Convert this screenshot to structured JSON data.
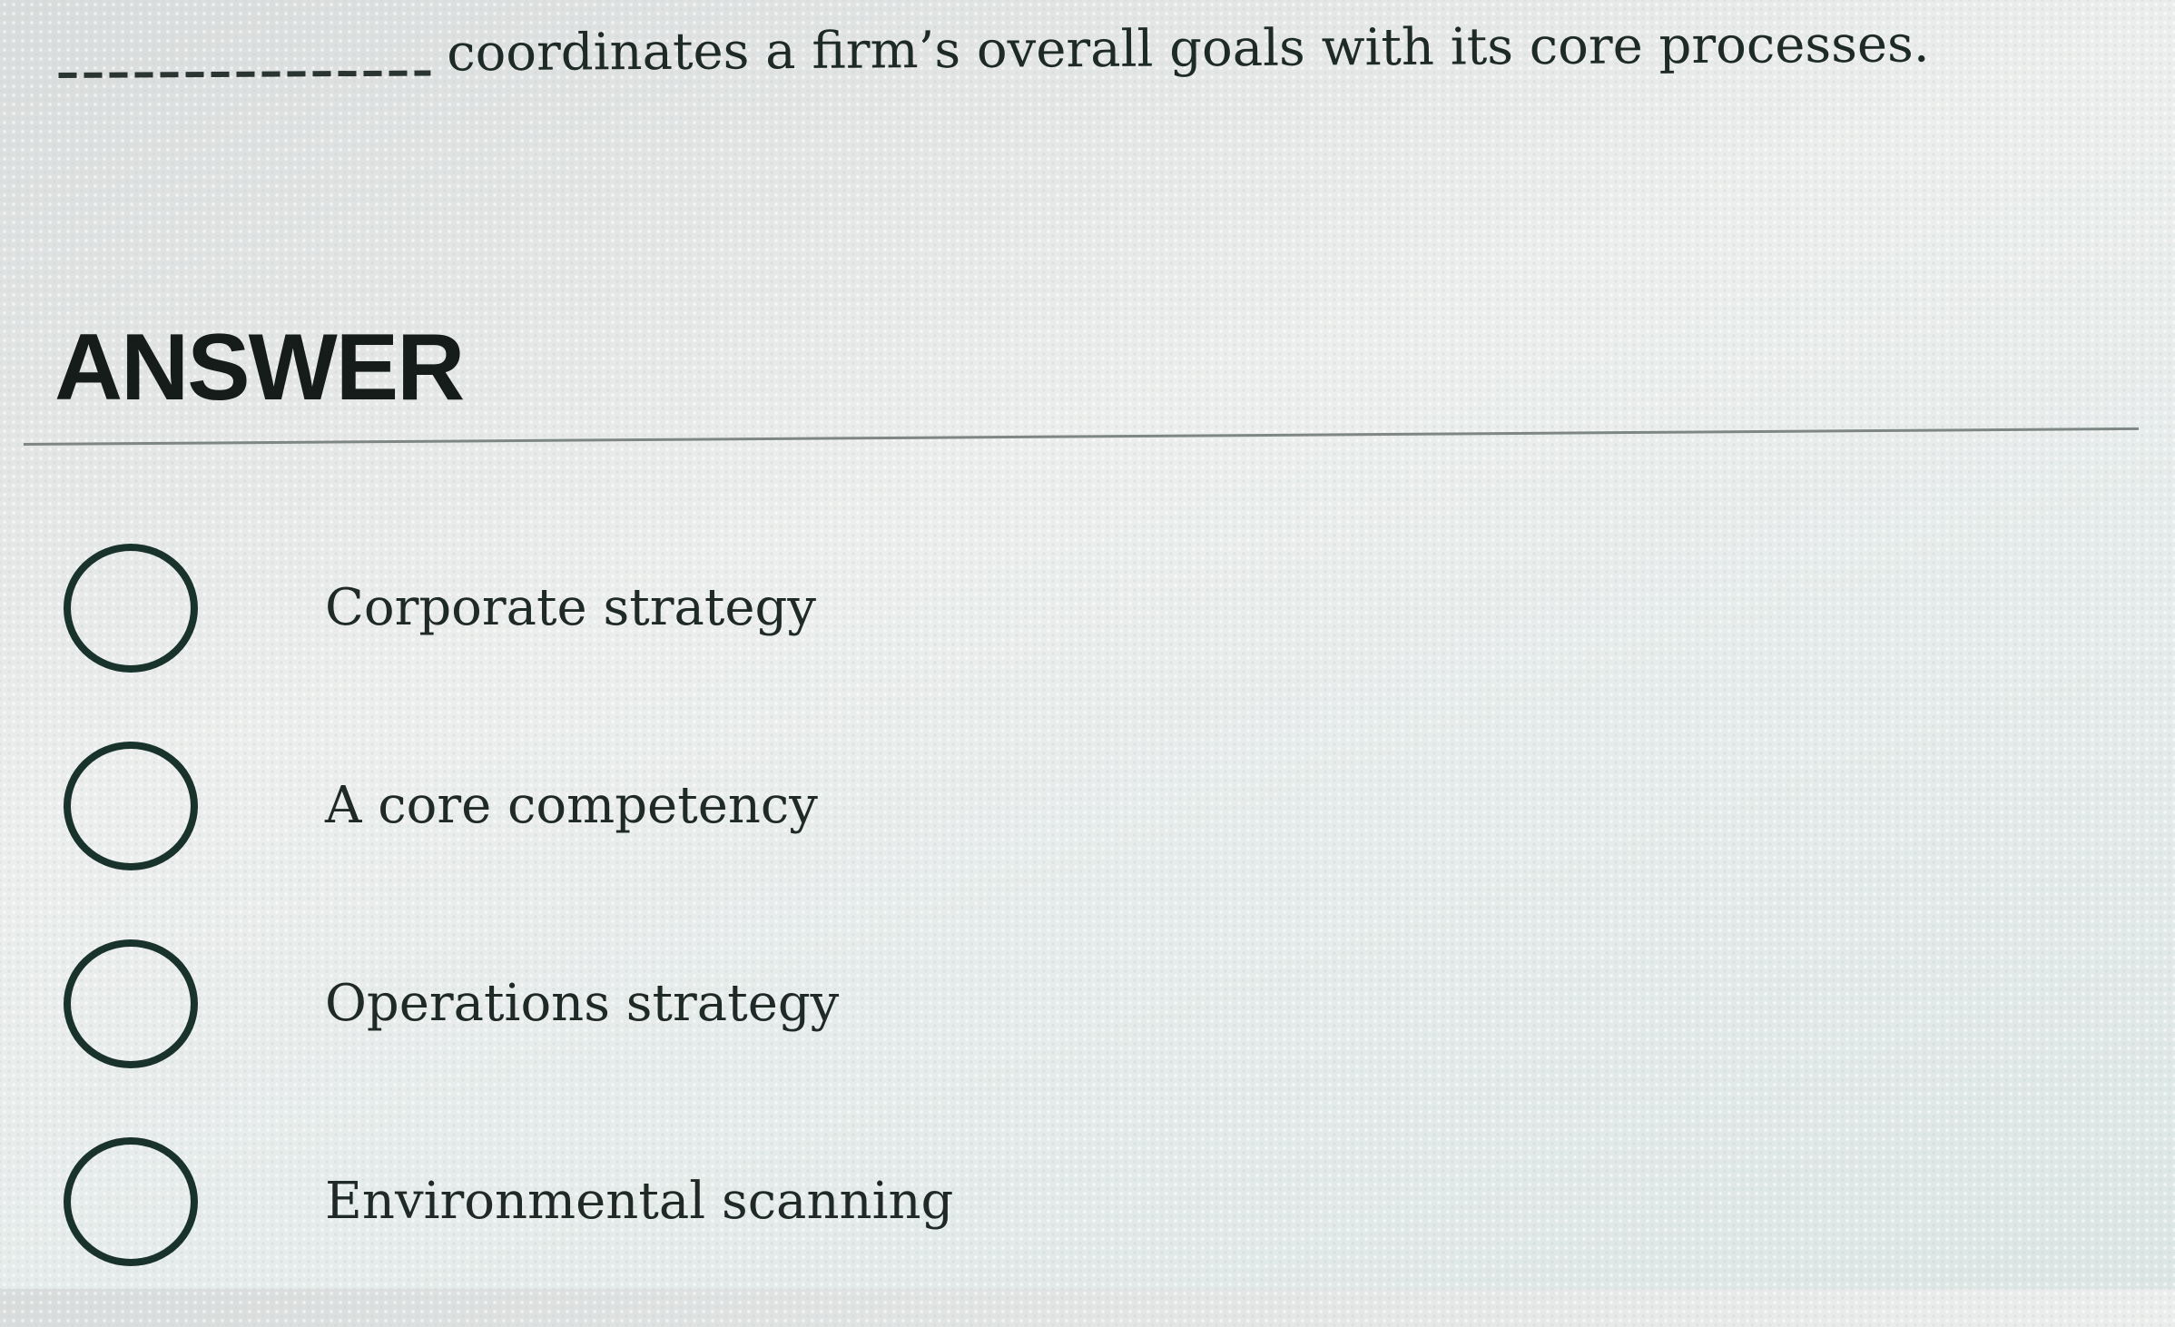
{
  "question": {
    "text": "coordinates a firm’s overall goals with its core processes."
  },
  "answer_heading": "ANSWER",
  "options": [
    {
      "label": "Corporate strategy",
      "selected": false
    },
    {
      "label": "A core competency",
      "selected": false
    },
    {
      "label": "Operations strategy",
      "selected": false
    },
    {
      "label": "Environmental scanning",
      "selected": false
    }
  ],
  "colors": {
    "text": "#1f2925",
    "radio_border": "#19332c",
    "divider": "#7e8784"
  }
}
